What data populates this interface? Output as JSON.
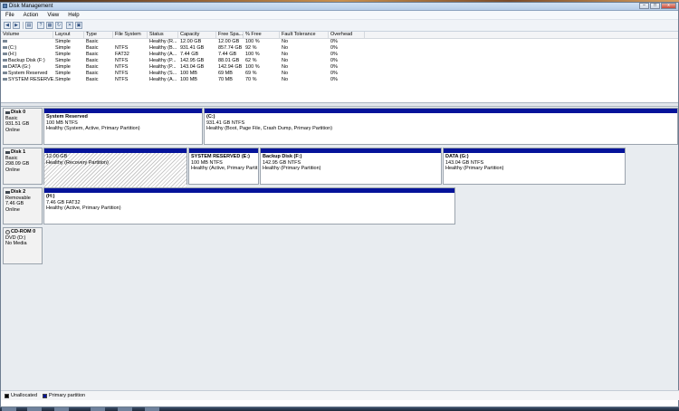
{
  "window": {
    "title": "Disk Management"
  },
  "menu": [
    "File",
    "Action",
    "View",
    "Help"
  ],
  "caption_buttons": {
    "minimize": "–",
    "maximize": "□",
    "close": "x"
  },
  "toolbar": {
    "icons": [
      "back-arrow-icon",
      "forward-arrow-icon",
      "console-tree-icon",
      "help-icon",
      "properties-icon",
      "refresh-icon",
      "delete-icon",
      "help-book-icon"
    ]
  },
  "volume_list": {
    "columns": [
      "Volume",
      "Layout",
      "Type",
      "File System",
      "Status",
      "Capacity",
      "Free Spa...",
      "% Free",
      "Fault Tolerance",
      "Overhead"
    ],
    "rows": [
      [
        "",
        "Simple",
        "Basic",
        "",
        "Healthy (R...",
        "12.00 GB",
        "12.00 GB",
        "100 %",
        "No",
        "0%"
      ],
      [
        "(C:)",
        "Simple",
        "Basic",
        "NTFS",
        "Healthy (B...",
        "931.41 GB",
        "857.74 GB",
        "92 %",
        "No",
        "0%"
      ],
      [
        "(H:)",
        "Simple",
        "Basic",
        "FAT32",
        "Healthy (A...",
        "7.44 GB",
        "7.44 GB",
        "100 %",
        "No",
        "0%"
      ],
      [
        "Backup Disk (F:)",
        "Simple",
        "Basic",
        "NTFS",
        "Healthy (P...",
        "142.95 GB",
        "88.01 GB",
        "62 %",
        "No",
        "0%"
      ],
      [
        "DATA (G:)",
        "Simple",
        "Basic",
        "NTFS",
        "Healthy (P...",
        "143.04 GB",
        "142.94 GB",
        "100 %",
        "No",
        "0%"
      ],
      [
        "System Reserved",
        "Simple",
        "Basic",
        "NTFS",
        "Healthy (S...",
        "100 MB",
        "69 MB",
        "69 %",
        "No",
        "0%"
      ],
      [
        "SYSTEM RESERVE...",
        "Simple",
        "Basic",
        "NTFS",
        "Healthy (A...",
        "100 MB",
        "70 MB",
        "70 %",
        "No",
        "0%"
      ]
    ]
  },
  "disks": [
    {
      "name": "Disk 0",
      "type": "Basic",
      "size": "931.51 GB",
      "status": "Online",
      "partitions": [
        {
          "name": "System Reserved",
          "detail": "100 MB NTFS",
          "health": "Healthy (System, Active, Primary Partition)"
        },
        {
          "name": "(C:)",
          "detail": "931.41 GB NTFS",
          "health": "Healthy (Boot, Page File, Crash Dump, Primary Partition)"
        }
      ]
    },
    {
      "name": "Disk 1",
      "type": "Basic",
      "size": "298.09 GB",
      "status": "Online",
      "partitions": [
        {
          "name": "",
          "detail": "12.00 GB",
          "health": "Healthy (Recovery Partition)"
        },
        {
          "name": "SYSTEM RESERVED  (E:)",
          "detail": "100 MB NTFS",
          "health": "Healthy (Active, Primary Partit"
        },
        {
          "name": "Backup Disk  (F:)",
          "detail": "142.95 GB NTFS",
          "health": "Healthy (Primary Partition)"
        },
        {
          "name": "DATA  (G:)",
          "detail": "143.04 GB NTFS",
          "health": "Healthy (Primary Partition)"
        }
      ]
    },
    {
      "name": "Disk 2",
      "type": "Removable",
      "size": "7.46 GB",
      "status": "Online",
      "partitions": [
        {
          "name": "(H:)",
          "detail": "7.46 GB FAT32",
          "health": "Healthy (Active, Primary Partition)"
        }
      ]
    },
    {
      "name": "CD-ROM 0",
      "type": "DVD (D:)",
      "size": "",
      "status": "No Media",
      "partitions": []
    }
  ],
  "legend": [
    "Unallocated",
    "Primary partition"
  ],
  "colors": {
    "primary_partition": "#05139a",
    "unallocated": "#000000"
  }
}
